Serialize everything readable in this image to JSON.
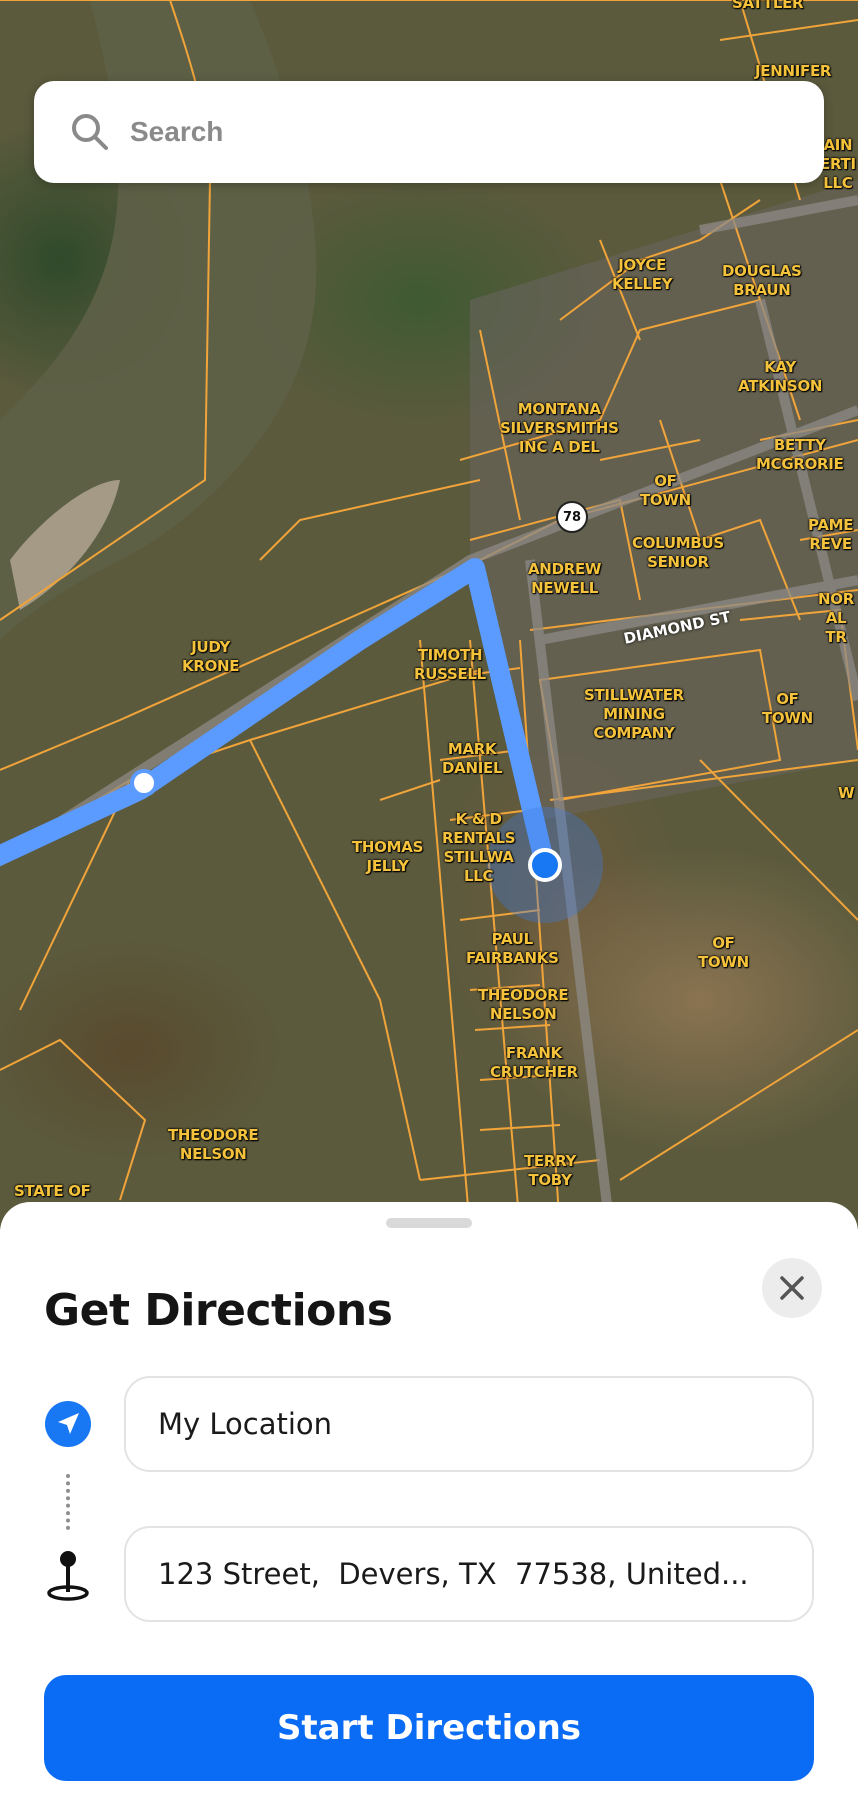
{
  "search": {
    "placeholder": "Search"
  },
  "map": {
    "parcels": [
      {
        "id": "sattler",
        "text": "SATTLER"
      },
      {
        "id": "jennifer",
        "text": "JENNIFER\nN"
      },
      {
        "id": "ain",
        "text": "AIN\nERTI\nLLC"
      },
      {
        "id": "joyce",
        "text": "JOYCE\nKELLEY"
      },
      {
        "id": "douglas",
        "text": "DOUGLAS\nBRAUN"
      },
      {
        "id": "kay",
        "text": "KAY\nATKINSON"
      },
      {
        "id": "montana",
        "text": "MONTANA\nSILVERSMITHS\nINC A DEL"
      },
      {
        "id": "betty",
        "text": "BETTY\nMCGRORIE"
      },
      {
        "id": "oftown1",
        "text": "OF\nTOWN"
      },
      {
        "id": "pame",
        "text": "PAME\nREVE"
      },
      {
        "id": "columbus",
        "text": "COLUMBUS\nSENIOR"
      },
      {
        "id": "andrew",
        "text": "ANDREW\nNEWELL"
      },
      {
        "id": "nor",
        "text": "NOR\nAL\nTR"
      },
      {
        "id": "judy",
        "text": "JUDY\nKRONE"
      },
      {
        "id": "timothy",
        "text": "TIMOTH\nRUSSELL"
      },
      {
        "id": "stillwater",
        "text": "STILLWATER\nMINING\nCOMPANY"
      },
      {
        "id": "oftown2",
        "text": "OF\nTOWN"
      },
      {
        "id": "mark",
        "text": "MARK\nDANIEL"
      },
      {
        "id": "w",
        "text": "W"
      },
      {
        "id": "kd",
        "text": "K & D\nRENTALS\nSTILLWA\nLLC"
      },
      {
        "id": "thomas",
        "text": "THOMAS\nJELLY"
      },
      {
        "id": "paul",
        "text": "PAUL\nFAIRBANKS"
      },
      {
        "id": "oftown3",
        "text": "OF\nTOWN"
      },
      {
        "id": "theodore1",
        "text": "THEODORE\nNELSON"
      },
      {
        "id": "frank",
        "text": "FRANK\nCRUTCHER"
      },
      {
        "id": "theodore2",
        "text": "THEODORE\nNELSON"
      },
      {
        "id": "terry",
        "text": "TERRY\nTOBY"
      },
      {
        "id": "stateof",
        "text": "STATE OF"
      }
    ],
    "street_name": "DIAMOND ST",
    "route_shield": "78",
    "colors": {
      "route": "#5b9bff",
      "parcel_line": "#f0a43a",
      "user_dot": "#1877f2"
    }
  },
  "directions": {
    "title": "Get Directions",
    "from_value": "My Location",
    "to_value": "123 Street,  Devers, TX  77538, United...",
    "start_label": "Start Directions",
    "accent": "#0a6cf5"
  }
}
